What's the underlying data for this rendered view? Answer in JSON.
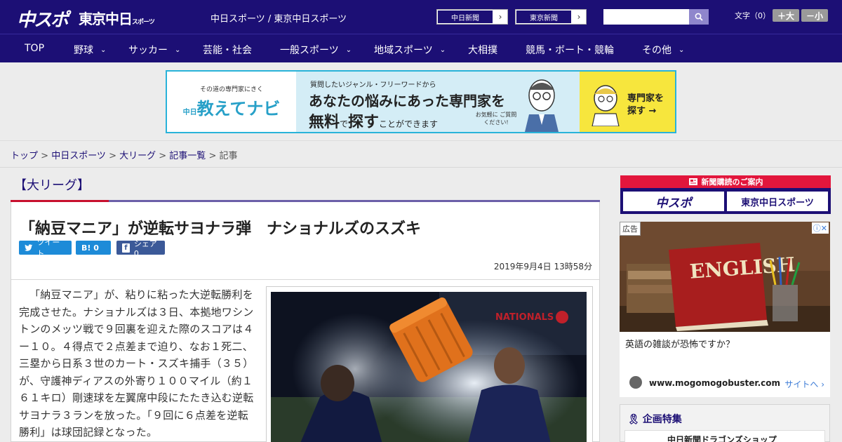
{
  "header": {
    "logo_chunichi": "中スポ",
    "logo_tokyo": "東京中日",
    "logo_tokyo_small": "スポーツ",
    "sites": "中日スポーツ / 東京中日スポーツ",
    "btn_chunichi": "中日新聞",
    "btn_tokyo": "東京新聞",
    "arrow": "›",
    "search_placeholder": "",
    "font_size_label": "文字（0）",
    "font_larger": "＋大",
    "font_smaller": "－小"
  },
  "nav": {
    "items": [
      "TOP",
      "野球",
      "サッカー",
      "芸能・社会",
      "一般スポーツ",
      "地域スポーツ",
      "大相撲",
      "競馬・ボート・競輪",
      "その他"
    ],
    "chevron": "⌄"
  },
  "banner": {
    "left_small": "その道の専門家にきく",
    "left_brand": "教えてナビ",
    "left_brand_prefix": "中日",
    "line1": "質問したいジャンル・フリーワードから",
    "line2": "あなたの悩みにあった専門家を",
    "line3a": "無料",
    "line3b": "で",
    "line3c": "探す",
    "line3d": "ことができます",
    "note": "お気軽に ご質問ください!",
    "cta": "専門家を 探す →"
  },
  "breadcrumb": {
    "items": [
      "トップ",
      "中日スポーツ",
      "大リーグ",
      "記事一覧"
    ],
    "current": "記事",
    "sep": " > "
  },
  "article": {
    "category": "【大リーグ】",
    "title": "「納豆マニア」が逆転サヨナラ弾　ナショナルズのスズキ",
    "tweet_label": "ツイート",
    "hatena_label": "B! 0",
    "facebook_label": "シェア 0",
    "date": "2019年9月4日 13時58分",
    "body": "「納豆マニア」が、粘りに粘った大逆転勝利を完成させた。ナショナルズは３日、本拠地ワシントンのメッツ戦で９回裏を迎えた際のスコアは４ー１０。４得点で２点差まで迫り、なお１死二、三塁から日系３世のカート・スズキ捕手（３５）が、守護神ディアスの外寄り１００マイル（約１６１キロ）剛速球を左翼席中段にたたき込む逆転サヨナラ３ランを放った。「９回に６点差を逆転勝利」は球団記録となった。",
    "photo_sign": "NATIONALS"
  },
  "sidebar": {
    "subscribe_title": "新聞購読のご案内",
    "subscribe_chunichi": "中スポ",
    "subscribe_tokyo": "東京中日スポーツ",
    "ad_tag": "広告",
    "ad_book": "ENGLISH",
    "ad_question": "英語の雑談が恐怖ですか？",
    "ad_url": "www.mogomogobuster.com",
    "ad_link": "サイトへ",
    "feature_title": "企画特集",
    "feature_item": "中日新聞ドラゴンズショップ"
  }
}
